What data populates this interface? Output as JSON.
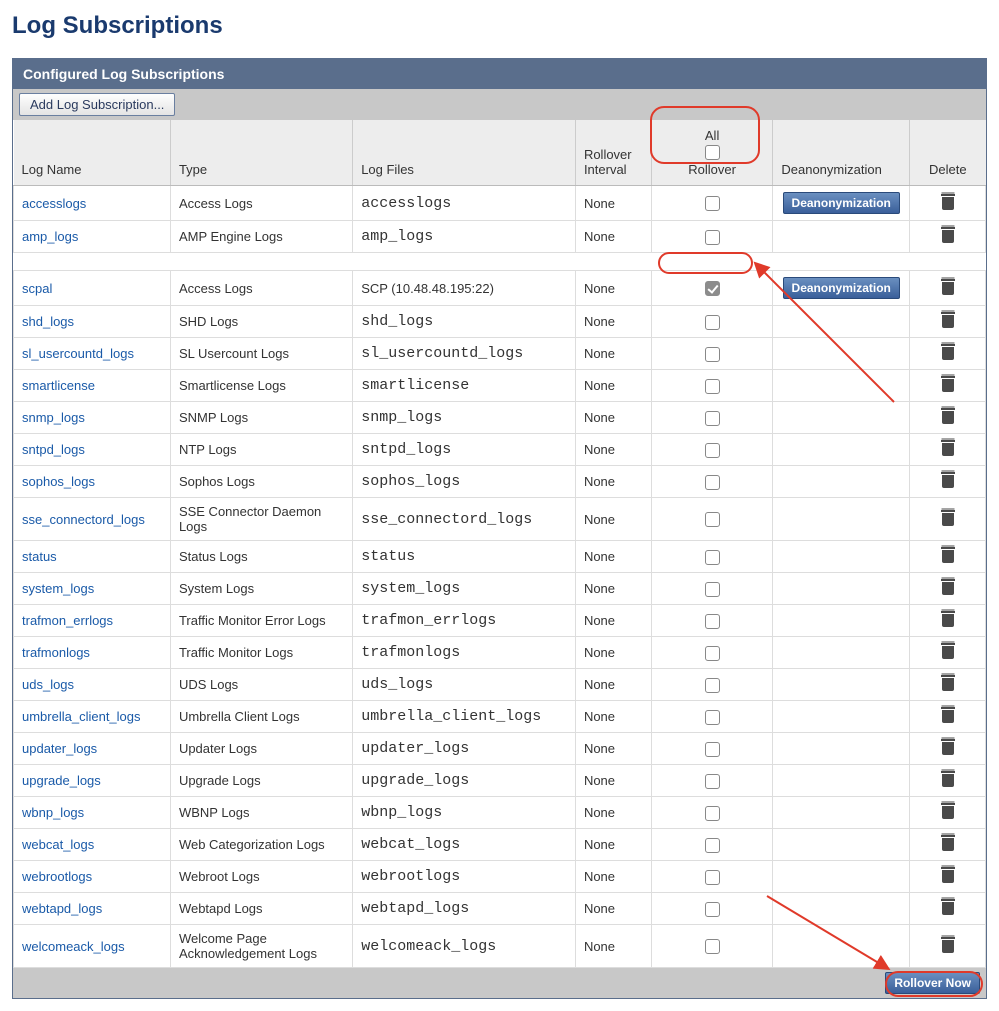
{
  "page_title": "Log Subscriptions",
  "panel_title": "Configured Log Subscriptions",
  "add_button": "Add Log Subscription...",
  "columns": {
    "name": "Log Name",
    "type": "Type",
    "files": "Log Files",
    "interval": "Rollover Interval",
    "rollover": "Rollover",
    "all": "All",
    "deanon": "Deanonymization",
    "delete": "Delete"
  },
  "deanon_button": "Deanonymization",
  "rollover_button": "Rollover Now",
  "rows_a": [
    {
      "name": "accesslogs",
      "type": "Access Logs",
      "files": "accesslogs",
      "interval": "None",
      "checked": false,
      "deanon": true
    },
    {
      "name": "amp_logs",
      "type": "AMP Engine Logs",
      "files": "amp_logs",
      "interval": "None",
      "checked": false,
      "deanon": false
    }
  ],
  "rows_b": [
    {
      "name": "scpal",
      "type": "Access Logs",
      "files": "SCP (10.48.48.195:22)",
      "mono": false,
      "interval": "None",
      "checked": true,
      "deanon": true
    },
    {
      "name": "shd_logs",
      "type": "SHD Logs",
      "files": "shd_logs",
      "mono": true,
      "interval": "None",
      "checked": false,
      "deanon": false
    },
    {
      "name": "sl_usercountd_logs",
      "type": "SL Usercount Logs",
      "files": "sl_usercountd_logs",
      "mono": true,
      "interval": "None",
      "checked": false,
      "deanon": false
    },
    {
      "name": "smartlicense",
      "type": "Smartlicense Logs",
      "files": "smartlicense",
      "mono": true,
      "interval": "None",
      "checked": false,
      "deanon": false
    },
    {
      "name": "snmp_logs",
      "type": "SNMP Logs",
      "files": "snmp_logs",
      "mono": true,
      "interval": "None",
      "checked": false,
      "deanon": false
    },
    {
      "name": "sntpd_logs",
      "type": "NTP Logs",
      "files": "sntpd_logs",
      "mono": true,
      "interval": "None",
      "checked": false,
      "deanon": false
    },
    {
      "name": "sophos_logs",
      "type": "Sophos Logs",
      "files": "sophos_logs",
      "mono": true,
      "interval": "None",
      "checked": false,
      "deanon": false
    },
    {
      "name": "sse_connectord_logs",
      "type": "SSE Connector Daemon Logs",
      "files": "sse_connectord_logs",
      "mono": true,
      "interval": "None",
      "checked": false,
      "deanon": false
    },
    {
      "name": "status",
      "type": "Status Logs",
      "files": "status",
      "mono": true,
      "interval": "None",
      "checked": false,
      "deanon": false
    },
    {
      "name": "system_logs",
      "type": "System Logs",
      "files": "system_logs",
      "mono": true,
      "interval": "None",
      "checked": false,
      "deanon": false
    },
    {
      "name": "trafmon_errlogs",
      "type": "Traffic Monitor Error Logs",
      "files": "trafmon_errlogs",
      "mono": true,
      "interval": "None",
      "checked": false,
      "deanon": false
    },
    {
      "name": "trafmonlogs",
      "type": "Traffic Monitor Logs",
      "files": "trafmonlogs",
      "mono": true,
      "interval": "None",
      "checked": false,
      "deanon": false
    },
    {
      "name": "uds_logs",
      "type": "UDS Logs",
      "files": "uds_logs",
      "mono": true,
      "interval": "None",
      "checked": false,
      "deanon": false
    },
    {
      "name": "umbrella_client_logs",
      "type": "Umbrella Client Logs",
      "files": "umbrella_client_logs",
      "mono": true,
      "interval": "None",
      "checked": false,
      "deanon": false
    },
    {
      "name": "updater_logs",
      "type": "Updater Logs",
      "files": "updater_logs",
      "mono": true,
      "interval": "None",
      "checked": false,
      "deanon": false
    },
    {
      "name": "upgrade_logs",
      "type": "Upgrade Logs",
      "files": "upgrade_logs",
      "mono": true,
      "interval": "None",
      "checked": false,
      "deanon": false
    },
    {
      "name": "wbnp_logs",
      "type": "WBNP Logs",
      "files": "wbnp_logs",
      "mono": true,
      "interval": "None",
      "checked": false,
      "deanon": false
    },
    {
      "name": "webcat_logs",
      "type": "Web Categorization Logs",
      "files": "webcat_logs",
      "mono": true,
      "interval": "None",
      "checked": false,
      "deanon": false
    },
    {
      "name": "webrootlogs",
      "type": "Webroot Logs",
      "files": "webrootlogs",
      "mono": true,
      "interval": "None",
      "checked": false,
      "deanon": false
    },
    {
      "name": "webtapd_logs",
      "type": "Webtapd Logs",
      "files": "webtapd_logs",
      "mono": true,
      "interval": "None",
      "checked": false,
      "deanon": false
    },
    {
      "name": "welcomeack_logs",
      "type": "Welcome Page Acknowledgement Logs",
      "files": "welcomeack_logs",
      "mono": true,
      "interval": "None",
      "checked": false,
      "deanon": false
    }
  ]
}
